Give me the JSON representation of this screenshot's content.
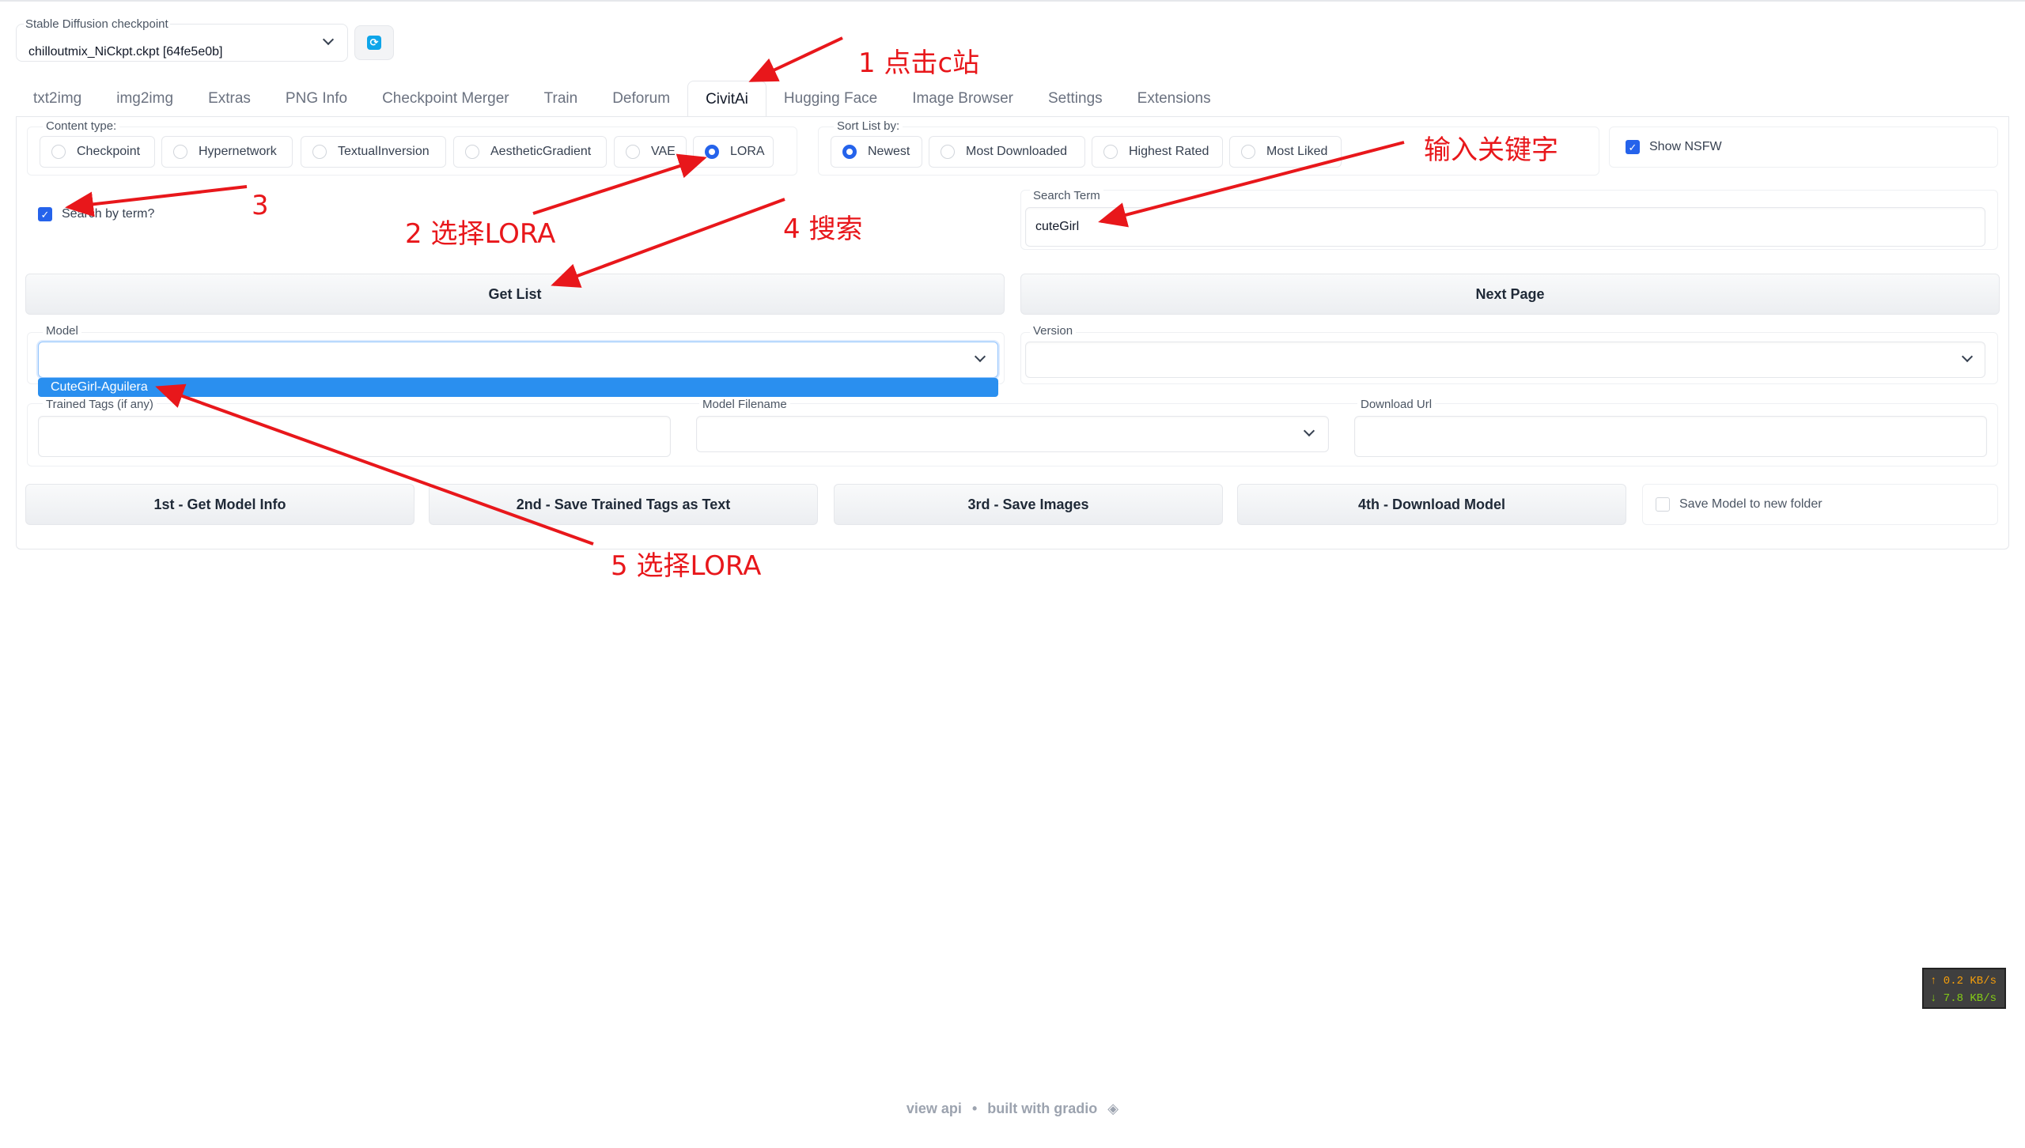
{
  "checkpoint": {
    "label": "Stable Diffusion checkpoint",
    "value": "chilloutmix_NiCkpt.ckpt [64fe5e0b]"
  },
  "tabs": [
    "txt2img",
    "img2img",
    "Extras",
    "PNG Info",
    "Checkpoint Merger",
    "Train",
    "Deforum",
    "CivitAi",
    "Hugging Face",
    "Image Browser",
    "Settings",
    "Extensions"
  ],
  "active_tab": "CivitAi",
  "content_type": {
    "label": "Content type:",
    "options": [
      "Checkpoint",
      "Hypernetwork",
      "TextualInversion",
      "AestheticGradient",
      "VAE",
      "LORA"
    ],
    "selected": "LORA"
  },
  "sort": {
    "label": "Sort List by:",
    "options": [
      "Newest",
      "Most Downloaded",
      "Highest Rated",
      "Most Liked"
    ],
    "selected": "Newest"
  },
  "show_nsfw": {
    "label": "Show NSFW",
    "checked": true
  },
  "search_by_term": {
    "label": "Search by term?",
    "checked": true
  },
  "search_term": {
    "label": "Search Term",
    "value": "cuteGirl"
  },
  "buttons": {
    "get_list": "Get List",
    "next_page": "Next Page",
    "get_model_info": "1st - Get Model Info",
    "save_tags": "2nd - Save Trained Tags as Text",
    "save_images": "3rd - Save Images",
    "download_model": "4th - Download Model"
  },
  "model": {
    "label": "Model",
    "value": "",
    "dropdown_option": "CuteGirl-Aguilera"
  },
  "version": {
    "label": "Version",
    "value": ""
  },
  "trained_tags": {
    "label": "Trained Tags (if any)",
    "value": ""
  },
  "model_filename": {
    "label": "Model Filename",
    "value": ""
  },
  "download_url": {
    "label": "Download Url",
    "value": ""
  },
  "save_new_folder": {
    "label": "Save Model to new folder",
    "checked": false
  },
  "annotations": {
    "a1": "1 点击c站",
    "a2": "2 选择LORA",
    "a3": "3",
    "a4": "4 搜索",
    "a5": "5 选择LORA",
    "a_keyword": "输入关键字"
  },
  "netmon": {
    "up": "↑ 0.2 KB/s",
    "down": "↓ 7.8 KB/s"
  },
  "footer": {
    "api": "view api",
    "sep": "•",
    "built": "built with gradio"
  },
  "colors": {
    "accent": "#2563eb",
    "annotation": "#e8171b",
    "selection": "#2a8fef"
  }
}
